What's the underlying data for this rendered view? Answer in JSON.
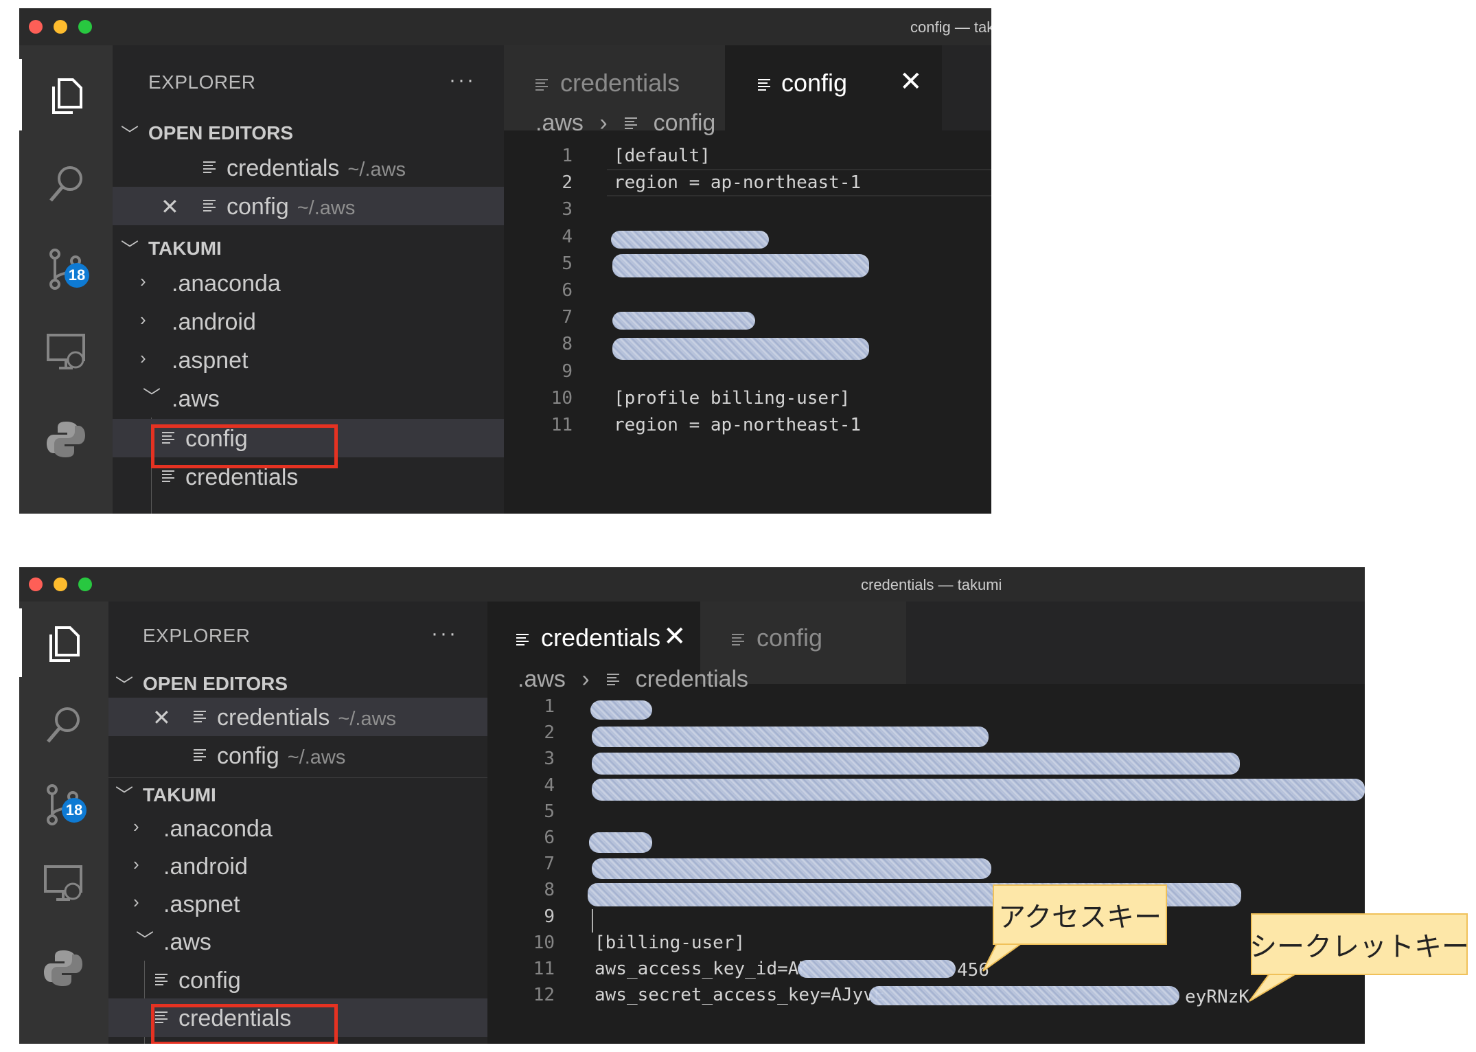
{
  "colors": {
    "editor_bg": "#1e1e1e",
    "sidebar_bg": "#252526",
    "activity_bg": "#333333",
    "badge_bg": "#0e7ad3",
    "highlight_border": "#e53222",
    "callout_bg": "#fde7a8"
  },
  "top_window": {
    "title": "config — tak",
    "activity": {
      "icons": [
        "files-icon",
        "search-icon",
        "source-control-icon",
        "remote-explorer-icon",
        "python-icon"
      ],
      "scm_badge": "18"
    },
    "explorer": {
      "header": "EXPLORER",
      "more": "···",
      "open_editors_title": "OPEN EDITORS",
      "open_editors": [
        {
          "name": "credentials",
          "path": "~/.aws"
        },
        {
          "name": "config",
          "path": "~/.aws"
        }
      ],
      "folder_title": "TAKUMI",
      "tree": [
        ".anaconda",
        ".android",
        ".aspnet",
        ".aws",
        "config",
        "credentials"
      ]
    },
    "tabs": [
      {
        "label": "credentials"
      },
      {
        "label": "config",
        "close": "✕"
      }
    ],
    "breadcrumb": {
      "folder": ".aws",
      "file": "config"
    },
    "lines": [
      {
        "n": "1",
        "text": "[default]"
      },
      {
        "n": "2",
        "text": "region = ap-northeast-1"
      },
      {
        "n": "3",
        "text": ""
      },
      {
        "n": "4",
        "text": ""
      },
      {
        "n": "5",
        "text": ""
      },
      {
        "n": "6",
        "text": ""
      },
      {
        "n": "7",
        "text": ""
      },
      {
        "n": "8",
        "text": ""
      },
      {
        "n": "9",
        "text": ""
      },
      {
        "n": "10",
        "text": "[profile billing-user]"
      },
      {
        "n": "11",
        "text": "region = ap-northeast-1"
      }
    ]
  },
  "bottom_window": {
    "title": "credentials — takumi",
    "activity": {
      "icons": [
        "files-icon",
        "search-icon",
        "source-control-icon",
        "remote-explorer-icon",
        "python-icon"
      ],
      "scm_badge": "18"
    },
    "explorer": {
      "header": "EXPLORER",
      "more": "···",
      "open_editors_title": "OPEN EDITORS",
      "open_editors": [
        {
          "name": "credentials",
          "path": "~/.aws"
        },
        {
          "name": "config",
          "path": "~/.aws"
        }
      ],
      "folder_title": "TAKUMI",
      "tree": [
        ".anaconda",
        ".android",
        ".aspnet",
        ".aws",
        "config",
        "credentials"
      ]
    },
    "tabs": [
      {
        "label": "credentials",
        "close": "✕"
      },
      {
        "label": "config"
      }
    ],
    "breadcrumb": {
      "folder": ".aws",
      "file": "credentials"
    },
    "lines": [
      {
        "n": "1",
        "text": ""
      },
      {
        "n": "2",
        "text": ""
      },
      {
        "n": "3",
        "text": ""
      },
      {
        "n": "4",
        "text": ""
      },
      {
        "n": "5",
        "text": ""
      },
      {
        "n": "6",
        "text": ""
      },
      {
        "n": "7",
        "text": ""
      },
      {
        "n": "8",
        "text": ""
      },
      {
        "n": "9",
        "text": ""
      },
      {
        "n": "10",
        "text": "[billing-user]"
      },
      {
        "n": "11",
        "text": "aws_access_key_id=AK"
      },
      {
        "n": "12",
        "text": "aws_secret_access_key=AJyvE"
      }
    ],
    "line11_tail": "456",
    "line12_tail": "eyRNzK"
  },
  "callouts": {
    "access_key": "アクセスキー",
    "secret_key": "シークレットキー"
  }
}
